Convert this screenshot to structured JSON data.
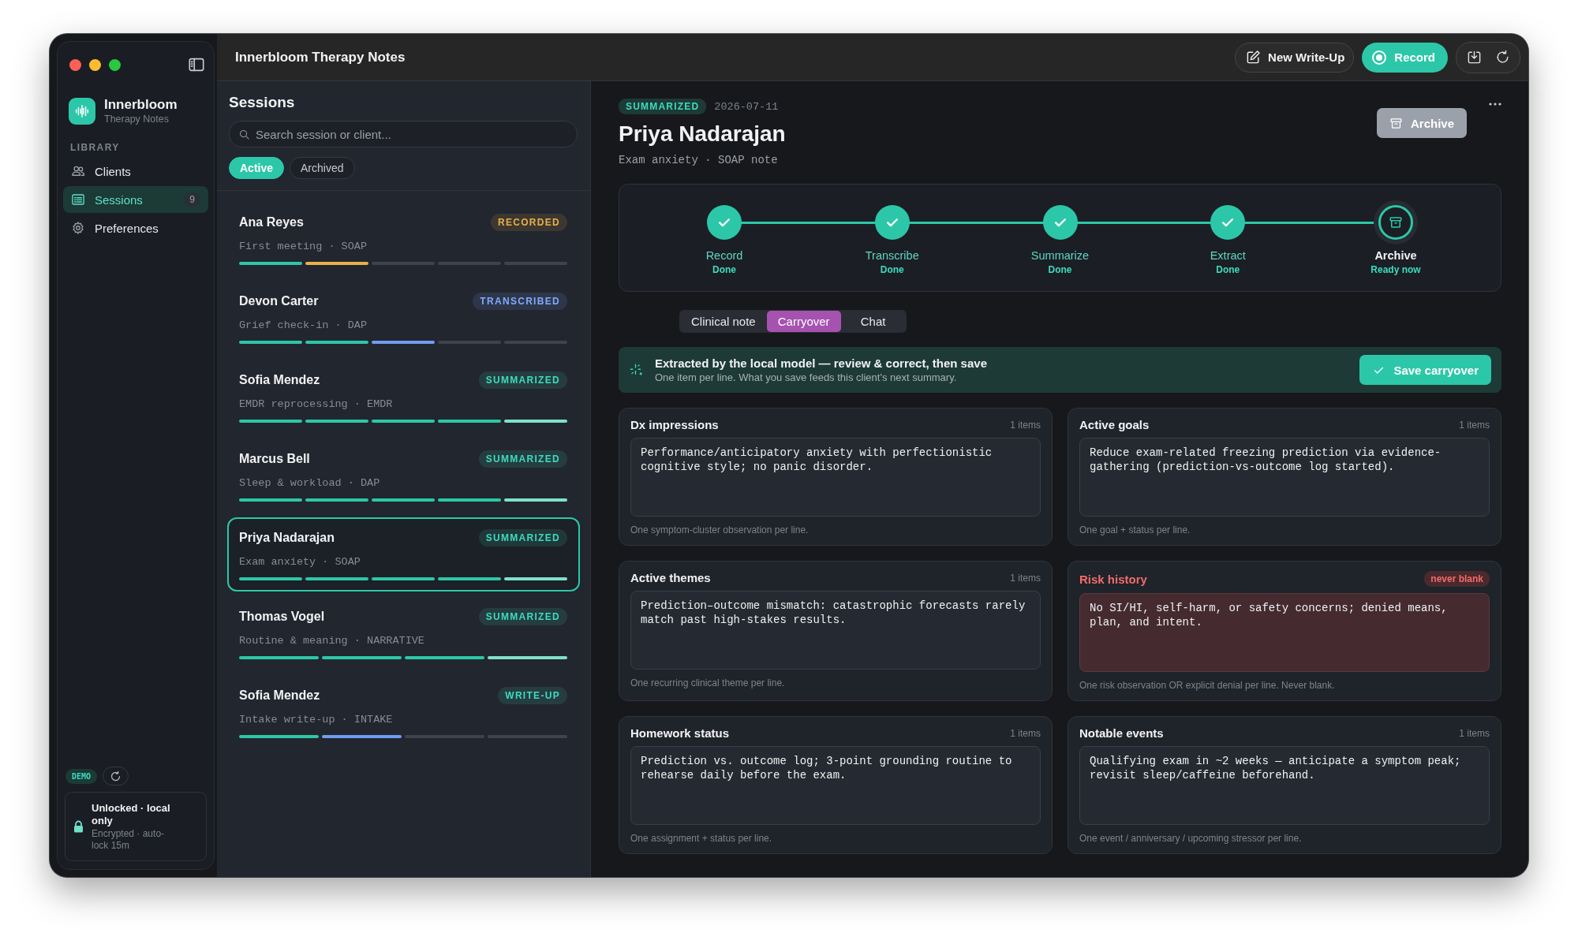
{
  "window": {
    "title": "Innerbloom Therapy Notes"
  },
  "toolbar": {
    "new_write_up": "New Write-Up",
    "record": "Record"
  },
  "sidebar": {
    "app_name": "Innerbloom",
    "app_subtitle": "Therapy Notes",
    "section": "LIBRARY",
    "items": [
      {
        "label": "Clients",
        "selected": false
      },
      {
        "label": "Sessions",
        "selected": true,
        "count": "9"
      },
      {
        "label": "Preferences",
        "selected": false
      }
    ],
    "demo_badge": "DEMO",
    "lock": {
      "title": "Unlocked · local only",
      "detail": "Encrypted · auto-lock 15m"
    }
  },
  "sessions": {
    "title": "Sessions",
    "search": {
      "placeholder": "Search session or client..."
    },
    "filters": [
      {
        "label": "Active",
        "selected": true
      },
      {
        "label": "Archived",
        "selected": false
      }
    ],
    "items": [
      {
        "name": "Ana Reyes",
        "status": "RECORDED",
        "color": "#e8b04a",
        "meta": "First meeting · SOAP",
        "selected": false,
        "segments": [
          {
            "color": "#2cc7a8"
          },
          {
            "color": "#e8b04a"
          },
          {
            "color": "#3f434b"
          },
          {
            "color": "#3f434b"
          },
          {
            "color": "#3f434b"
          }
        ]
      },
      {
        "name": "Devon Carter",
        "status": "TRANSCRIBED",
        "color": "#82aaff",
        "meta": "Grief check-in · DAP",
        "selected": false,
        "segments": [
          {
            "color": "#2cc7a8"
          },
          {
            "color": "#2cc7a8"
          },
          {
            "color": "#6f9cf2"
          },
          {
            "color": "#3f434b"
          },
          {
            "color": "#3f434b"
          }
        ]
      },
      {
        "name": "Sofia Mendez",
        "status": "SUMMARIZED",
        "color": "#3ddbbd",
        "meta": "EMDR reprocessing · EMDR",
        "selected": false,
        "segments": [
          {
            "color": "#2cc7a8"
          },
          {
            "color": "#2cc7a8"
          },
          {
            "color": "#2cc7a8"
          },
          {
            "color": "#2cc7a8"
          },
          {
            "color": "#7fe0cc"
          }
        ]
      },
      {
        "name": "Marcus Bell",
        "status": "SUMMARIZED",
        "color": "#3ddbbd",
        "meta": "Sleep & workload · DAP",
        "selected": false,
        "segments": [
          {
            "color": "#2cc7a8"
          },
          {
            "color": "#2cc7a8"
          },
          {
            "color": "#2cc7a8"
          },
          {
            "color": "#2cc7a8"
          },
          {
            "color": "#7fe0cc"
          }
        ]
      },
      {
        "name": "Priya Nadarajan",
        "status": "SUMMARIZED",
        "color": "#3ddbbd",
        "meta": "Exam anxiety · SOAP",
        "selected": true,
        "segments": [
          {
            "color": "#2cc7a8"
          },
          {
            "color": "#2cc7a8"
          },
          {
            "color": "#2cc7a8"
          },
          {
            "color": "#2cc7a8"
          },
          {
            "color": "#7fe0cc"
          }
        ]
      },
      {
        "name": "Thomas Vogel",
        "status": "SUMMARIZED",
        "color": "#3ddbbd",
        "meta": "Routine & meaning · NARRATIVE",
        "selected": false,
        "segments": [
          {
            "color": "#2cc7a8"
          },
          {
            "color": "#2cc7a8"
          },
          {
            "color": "#2cc7a8"
          },
          {
            "color": "#7fe0cc"
          }
        ]
      },
      {
        "name": "Sofia Mendez",
        "status": "WRITE-UP",
        "color": "#3ddbbd",
        "meta": "Intake write-up · INTAKE",
        "selected": false,
        "segments": [
          {
            "color": "#2cc7a8"
          },
          {
            "color": "#6f9cf2"
          },
          {
            "color": "#3f434b"
          },
          {
            "color": "#3f434b"
          }
        ]
      }
    ]
  },
  "detail": {
    "status": "SUMMARIZED",
    "date": "2026-07-11",
    "name": "Priya Nadarajan",
    "subtitle": "Exam anxiety · SOAP note",
    "archive_button": "Archive",
    "pipeline": [
      {
        "label": "Record",
        "state_text": "Done",
        "done": true
      },
      {
        "label": "Transcribe",
        "state_text": "Done",
        "done": true
      },
      {
        "label": "Summarize",
        "state_text": "Done",
        "done": true
      },
      {
        "label": "Extract",
        "state_text": "Done",
        "done": true
      },
      {
        "label": "Archive",
        "state_text": "Ready now",
        "done": false
      }
    ],
    "tabs": [
      {
        "label": "Clinical note",
        "selected": false
      },
      {
        "label": "Carryover",
        "selected": true
      },
      {
        "label": "Chat",
        "selected": false
      }
    ],
    "banner": {
      "title": "Extracted by the local model — review & correct, then save",
      "subtitle": "One item per line. What you save feeds this client's next summary.",
      "button": "Save carryover"
    },
    "cards": [
      {
        "kind": "normal",
        "title": "Dx impressions",
        "count": "1 items",
        "value": "Performance/anticipatory anxiety with perfectionistic cognitive style; no panic disorder.",
        "hint": "One symptom-cluster observation per line."
      },
      {
        "kind": "normal",
        "title": "Active goals",
        "count": "1 items",
        "value": "Reduce exam-related freezing prediction via evidence-gathering (prediction-vs-outcome log started).",
        "hint": "One goal + status per line."
      },
      {
        "kind": "normal",
        "title": "Active themes",
        "count": "1 items",
        "value": "Prediction–outcome mismatch: catastrophic forecasts rarely match past high-stakes results.",
        "hint": "One recurring clinical theme per line."
      },
      {
        "kind": "risk",
        "title": "Risk history",
        "badge": "never blank",
        "value": "No SI/HI, self-harm, or safety concerns; denied means, plan, and intent.",
        "hint": "One risk observation OR explicit denial per line. Never blank."
      },
      {
        "kind": "normal",
        "title": "Homework status",
        "count": "1 items",
        "value": "Prediction vs. outcome log; 3-point grounding routine to rehearse daily before the exam.",
        "hint": "One assignment + status per line."
      },
      {
        "kind": "normal",
        "title": "Notable events",
        "count": "1 items",
        "value": "Qualifying exam in ~2 weeks — anticipate a symptom peak; revisit sleep/caffeine beforehand.",
        "hint": "One event / anniversary / upcoming stressor per line."
      }
    ]
  }
}
